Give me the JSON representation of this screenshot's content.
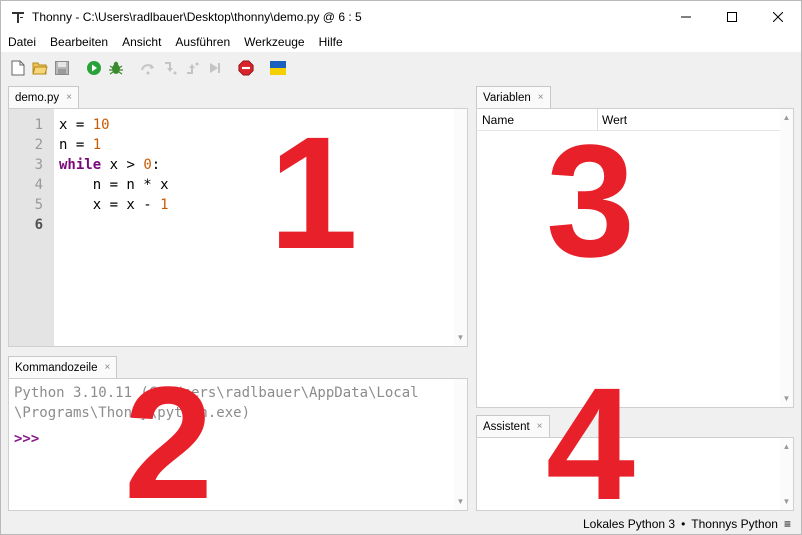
{
  "window": {
    "title": "Thonny  -  C:\\Users\\radlbauer\\Desktop\\thonny\\demo.py  @  6 : 5",
    "app_icon": "thonny-logo-icon",
    "controls": [
      "minimize-icon",
      "maximize-icon",
      "close-icon"
    ]
  },
  "menu": {
    "items": [
      "Datei",
      "Bearbeiten",
      "Ansicht",
      "Ausführen",
      "Werkzeuge",
      "Hilfe"
    ]
  },
  "toolbar": {
    "icons": [
      "new-file-icon",
      "open-folder-icon",
      "save-icon",
      "run-icon",
      "debug-icon",
      "step-over-icon",
      "step-into-icon",
      "step-out-icon",
      "resume-icon",
      "stop-icon",
      "ukraine-flag-icon"
    ]
  },
  "editor": {
    "tab_label": "demo.py",
    "tab_close": "×",
    "line_numbers": [
      "1",
      "2",
      "3",
      "4",
      "5",
      "6"
    ],
    "current_line": "6",
    "lines": [
      {
        "a": "x = ",
        "b": "10",
        "c": ""
      },
      {
        "a": "n = ",
        "b": "1",
        "c": ""
      },
      {
        "kw": "while",
        "a": " x > ",
        "b": "0",
        "c": ":"
      },
      {
        "a": "    n = n * x",
        "b": "",
        "c": ""
      },
      {
        "a": "    x = x - ",
        "b": "1",
        "c": ""
      }
    ]
  },
  "shell": {
    "tab_label": "Kommandozeile",
    "tab_close": "×",
    "line1": "Python 3.10.11 (C:\\Users\\radlbauer\\AppData\\Local",
    "line2": "\\Programs\\Thonny\\python.exe)",
    "prompt": ">>>"
  },
  "variables": {
    "tab_label": "Variablen",
    "tab_close": "×",
    "col_name": "Name",
    "col_value": "Wert"
  },
  "assistant": {
    "tab_label": "Assistent",
    "tab_close": "×"
  },
  "overlay_numbers": [
    "1",
    "2",
    "3",
    "4"
  ],
  "statusbar": {
    "interpreter": "Lokales Python 3",
    "separator": "•",
    "python_name": "Thonnys Python",
    "menu_glyph": "≡"
  },
  "colors": {
    "keyword": "#7a0a7a",
    "number": "#c85a00",
    "overlay": "#e8202a",
    "prompt": "#8a1a8a"
  }
}
